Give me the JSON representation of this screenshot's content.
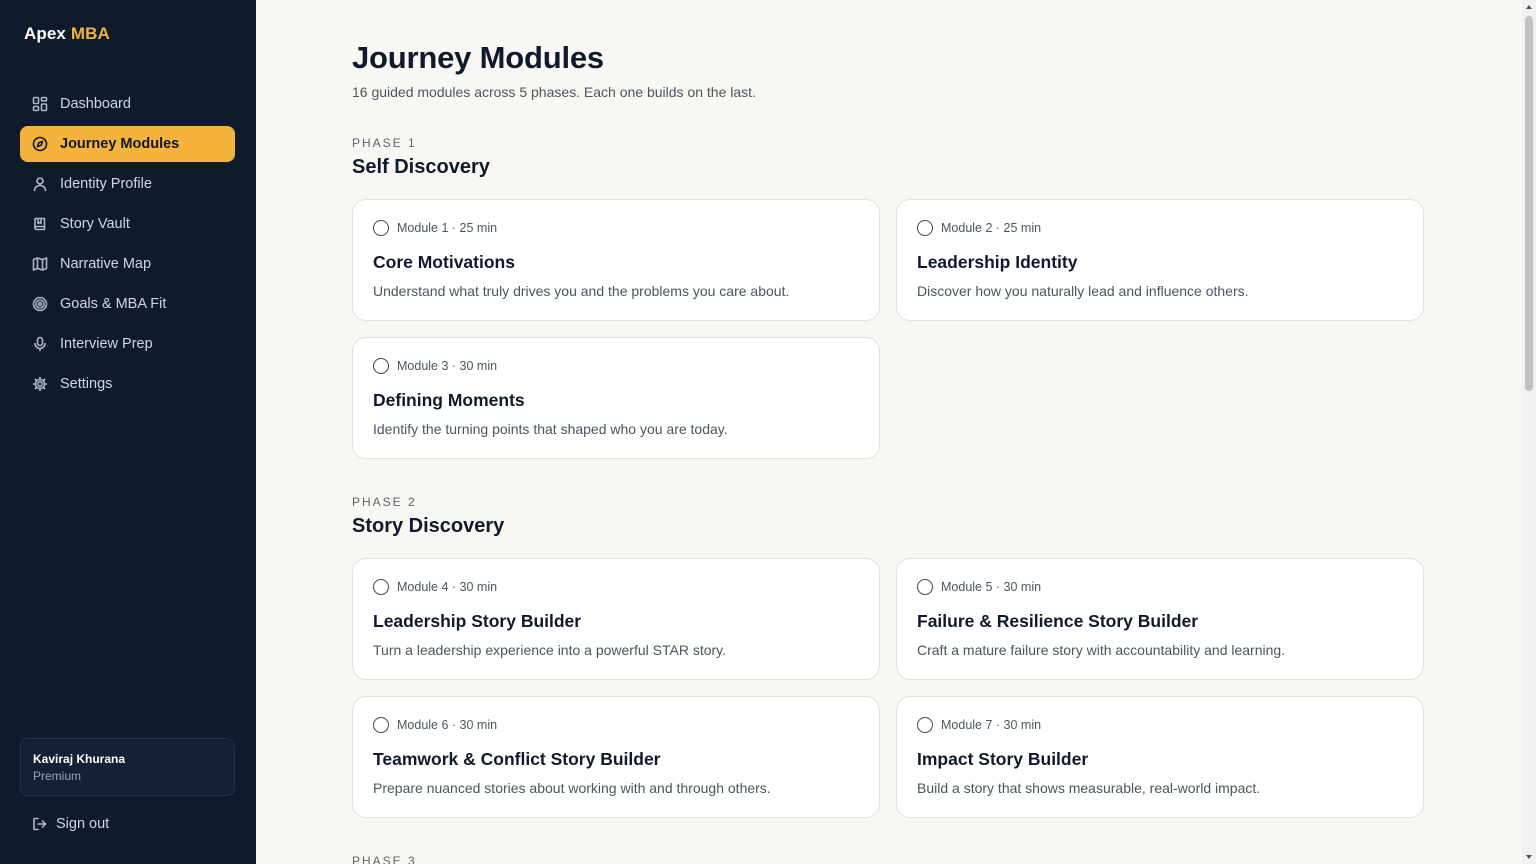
{
  "brand": {
    "name": "Apex",
    "accent": "MBA"
  },
  "nav": [
    {
      "label": "Dashboard",
      "icon": "dashboard-icon"
    },
    {
      "label": "Journey Modules",
      "icon": "compass-icon",
      "active": true
    },
    {
      "label": "Identity Profile",
      "icon": "user-icon"
    },
    {
      "label": "Story Vault",
      "icon": "book-icon"
    },
    {
      "label": "Narrative Map",
      "icon": "map-icon"
    },
    {
      "label": "Goals & MBA Fit",
      "icon": "target-icon"
    },
    {
      "label": "Interview Prep",
      "icon": "microphone-icon"
    },
    {
      "label": "Settings",
      "icon": "gear-icon"
    }
  ],
  "user": {
    "name": "Kaviraj Khurana",
    "plan": "Premium"
  },
  "signout": {
    "label": "Sign out",
    "icon": "logout-icon"
  },
  "page": {
    "title": "Journey Modules",
    "subtitle": "16 guided modules across 5 phases. Each one builds on the last."
  },
  "phases": [
    {
      "label": "PHASE 1",
      "title": "Self Discovery",
      "modules": [
        {
          "meta": "Module 1 · 25 min",
          "title": "Core Motivations",
          "desc": "Understand what truly drives you and the problems you care about."
        },
        {
          "meta": "Module 2 · 25 min",
          "title": "Leadership Identity",
          "desc": "Discover how you naturally lead and influence others."
        },
        {
          "meta": "Module 3 · 30 min",
          "title": "Defining Moments",
          "desc": "Identify the turning points that shaped who you are today."
        }
      ]
    },
    {
      "label": "PHASE 2",
      "title": "Story Discovery",
      "modules": [
        {
          "meta": "Module 4 · 30 min",
          "title": "Leadership Story Builder",
          "desc": "Turn a leadership experience into a powerful STAR story."
        },
        {
          "meta": "Module 5 · 30 min",
          "title": "Failure & Resilience Story Builder",
          "desc": "Craft a mature failure story with accountability and learning."
        },
        {
          "meta": "Module 6 · 30 min",
          "title": "Teamwork & Conflict Story Builder",
          "desc": "Prepare nuanced stories about working with and through others."
        },
        {
          "meta": "Module 7 · 30 min",
          "title": "Impact Story Builder",
          "desc": "Build a story that shows measurable, real-world impact."
        }
      ]
    },
    {
      "label": "PHASE 3",
      "title": "",
      "modules": []
    }
  ],
  "colors": {
    "sidebar": "#0f1a2b",
    "accent": "#f4b33d",
    "background": "#f8f7f4",
    "card": "#ffffff"
  }
}
